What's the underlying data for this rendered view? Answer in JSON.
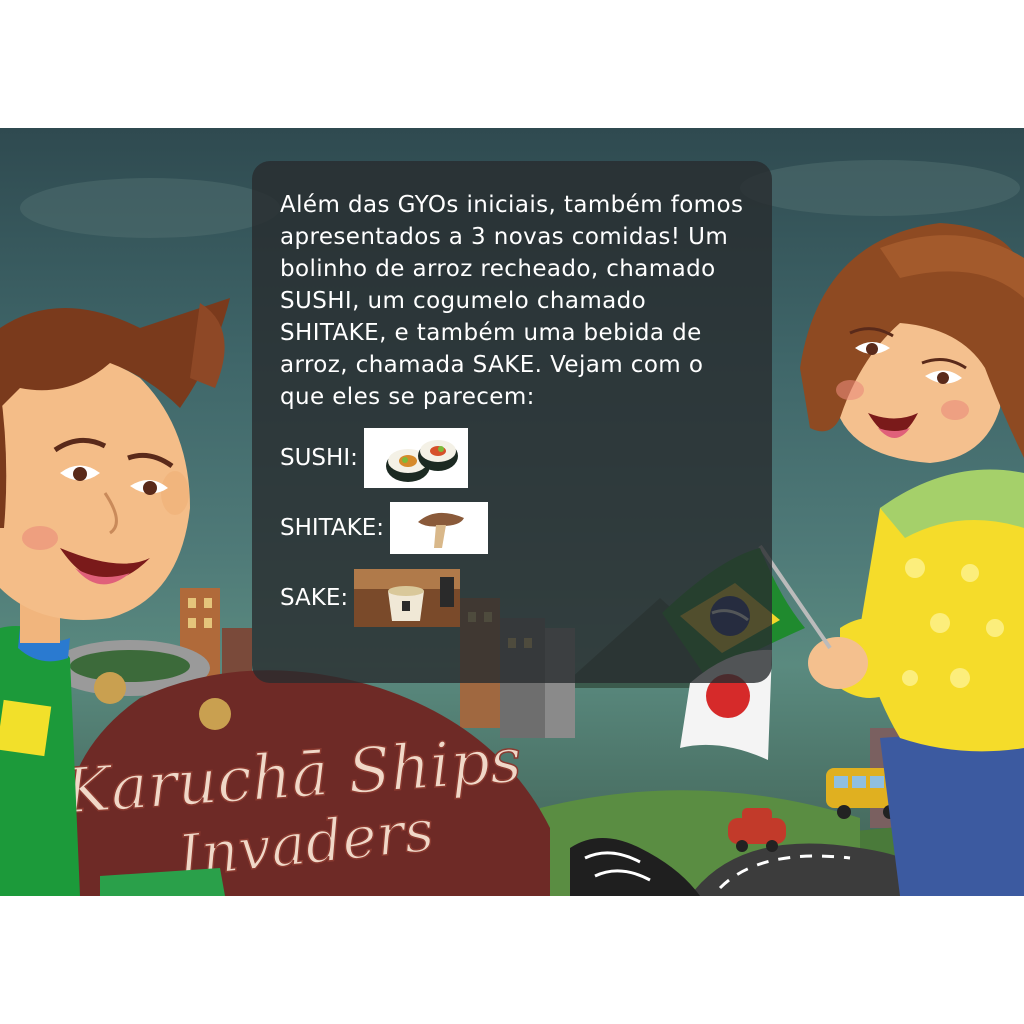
{
  "dialog": {
    "text": "Além das GYOs iniciais, também fomos apresentados a 3 novas comidas! Um bolinho de arroz recheado, chamado SUSHI, um cogumelo chamado SHITAKE, e também uma bebida de arroz, chamada SAKE. Vejam com o que eles se parecem:",
    "items": [
      {
        "label": "SUSHI:",
        "image": "sushi-photo"
      },
      {
        "label": "SHITAKE:",
        "image": "shitake-photo"
      },
      {
        "label": "SAKE:",
        "image": "sake-cup-photo"
      }
    ]
  },
  "logo": {
    "line1": "Karuchā Ships",
    "line2": "Invaders"
  },
  "characters": {
    "left": "boy-character",
    "right": "girl-character"
  },
  "flags": [
    "brazil-flag",
    "japan-flag"
  ],
  "colors": {
    "dialog_bg": "#282c2e",
    "boy_shirt": "#1c9a3a",
    "girl_shirt": "#f5dc2a",
    "logo_text": "#f0d8c8"
  }
}
